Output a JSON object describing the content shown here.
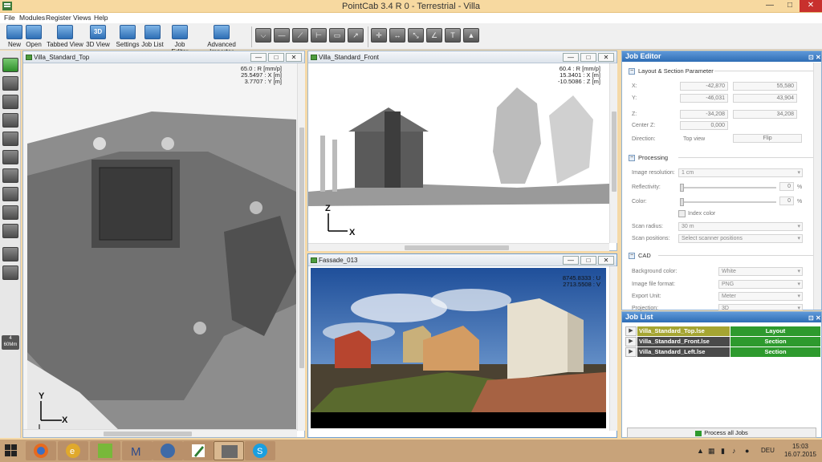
{
  "window": {
    "title": "PointCab 3.4 R 0 - Terrestrial - Villa",
    "controls": {
      "minimize": "—",
      "maximize": "□",
      "close": "✕"
    }
  },
  "menu": [
    "File",
    "Modules",
    "Register",
    "Views",
    "Help"
  ],
  "toolbar": {
    "buttons": [
      {
        "label": "New",
        "icon": "new-file-icon"
      },
      {
        "label": "Open",
        "icon": "open-folder-icon"
      },
      {
        "label": "Tabbed View",
        "icon": "tabbed-view-icon"
      },
      {
        "label": "3D View",
        "icon": "3d-view-icon",
        "glyph": "3D"
      },
      {
        "label": "Settings",
        "icon": "gear-icon"
      },
      {
        "label": "Job List",
        "icon": "job-list-icon"
      },
      {
        "label": "Job Editor",
        "icon": "job-editor-icon"
      },
      {
        "label": "Advanced Importer",
        "icon": "importer-icon"
      }
    ]
  },
  "views": {
    "top": {
      "title": "Villa_Standard_Top",
      "coords": [
        "65.0 : R [mm/p]",
        "25.5497 : X [m]",
        "3.7707 : Y [m]"
      ],
      "axis_v": "Y",
      "axis_h": "X"
    },
    "front": {
      "title": "Villa_Standard_Front",
      "coords": [
        "60.4 : R [mm/p]",
        "15.3401 : X [m]",
        "-10.5086 : Z [m]"
      ],
      "axis_v": "Z",
      "axis_h": "X"
    },
    "pano": {
      "title": "Fassade_013",
      "coords": [
        "8745.8333 : U",
        "2713.5508 : V"
      ]
    }
  },
  "job_editor": {
    "title": "Job Editor",
    "sections": {
      "layout": "Layout & Section Parameter",
      "processing": "Processing",
      "cad": "CAD"
    },
    "fields": {
      "x_label": "X:",
      "x_min": "-42,870",
      "x_max": "55,580",
      "y_label": "Y:",
      "y_min": "-46,031",
      "y_max": "43,904",
      "z_label": "Z:",
      "z_min": "-34,208",
      "z_max": "34,208",
      "center_label": "Center Z:",
      "center_val": "0,000",
      "direction_label": "Direction:",
      "direction_val": "Top view",
      "flip": "Flip",
      "resolution_label": "Image resolution:",
      "resolution_val": "1 cm",
      "reflectivity_label": "Reflectivity:",
      "reflectivity_val": "0",
      "color_label": "Color:",
      "color_val": "0",
      "percent": "%",
      "index_color": "Index color",
      "scan_radius_label": "Scan radius:",
      "scan_radius_val": "30 m",
      "scan_positions_label": "Scan positions:",
      "scan_positions_val": "Select scanner positions",
      "bg_label": "Background color:",
      "bg_val": "White",
      "format_label": "Image file format:",
      "format_val": "PNG",
      "unit_label": "Export Unit:",
      "unit_val": "Meter",
      "projection_label": "Projection:",
      "projection_val": "3D"
    }
  },
  "job_list": {
    "title": "Job List",
    "jobs": [
      {
        "name": "Villa_Standard_Top.lse",
        "type": "Layout",
        "color": "#a5a532"
      },
      {
        "name": "Villa_Standard_Front.lse",
        "type": "Section",
        "color": "#4a4a4a"
      },
      {
        "name": "Villa_Standard_Left.lse",
        "type": "Section",
        "color": "#4a4a4a"
      }
    ],
    "process_button": "Process all Jobs"
  },
  "left_tools": {
    "scale_label": "4\n60Mm"
  },
  "taskbar": {
    "time": "15:03",
    "date": "16.07.2015",
    "language": "DEU"
  }
}
